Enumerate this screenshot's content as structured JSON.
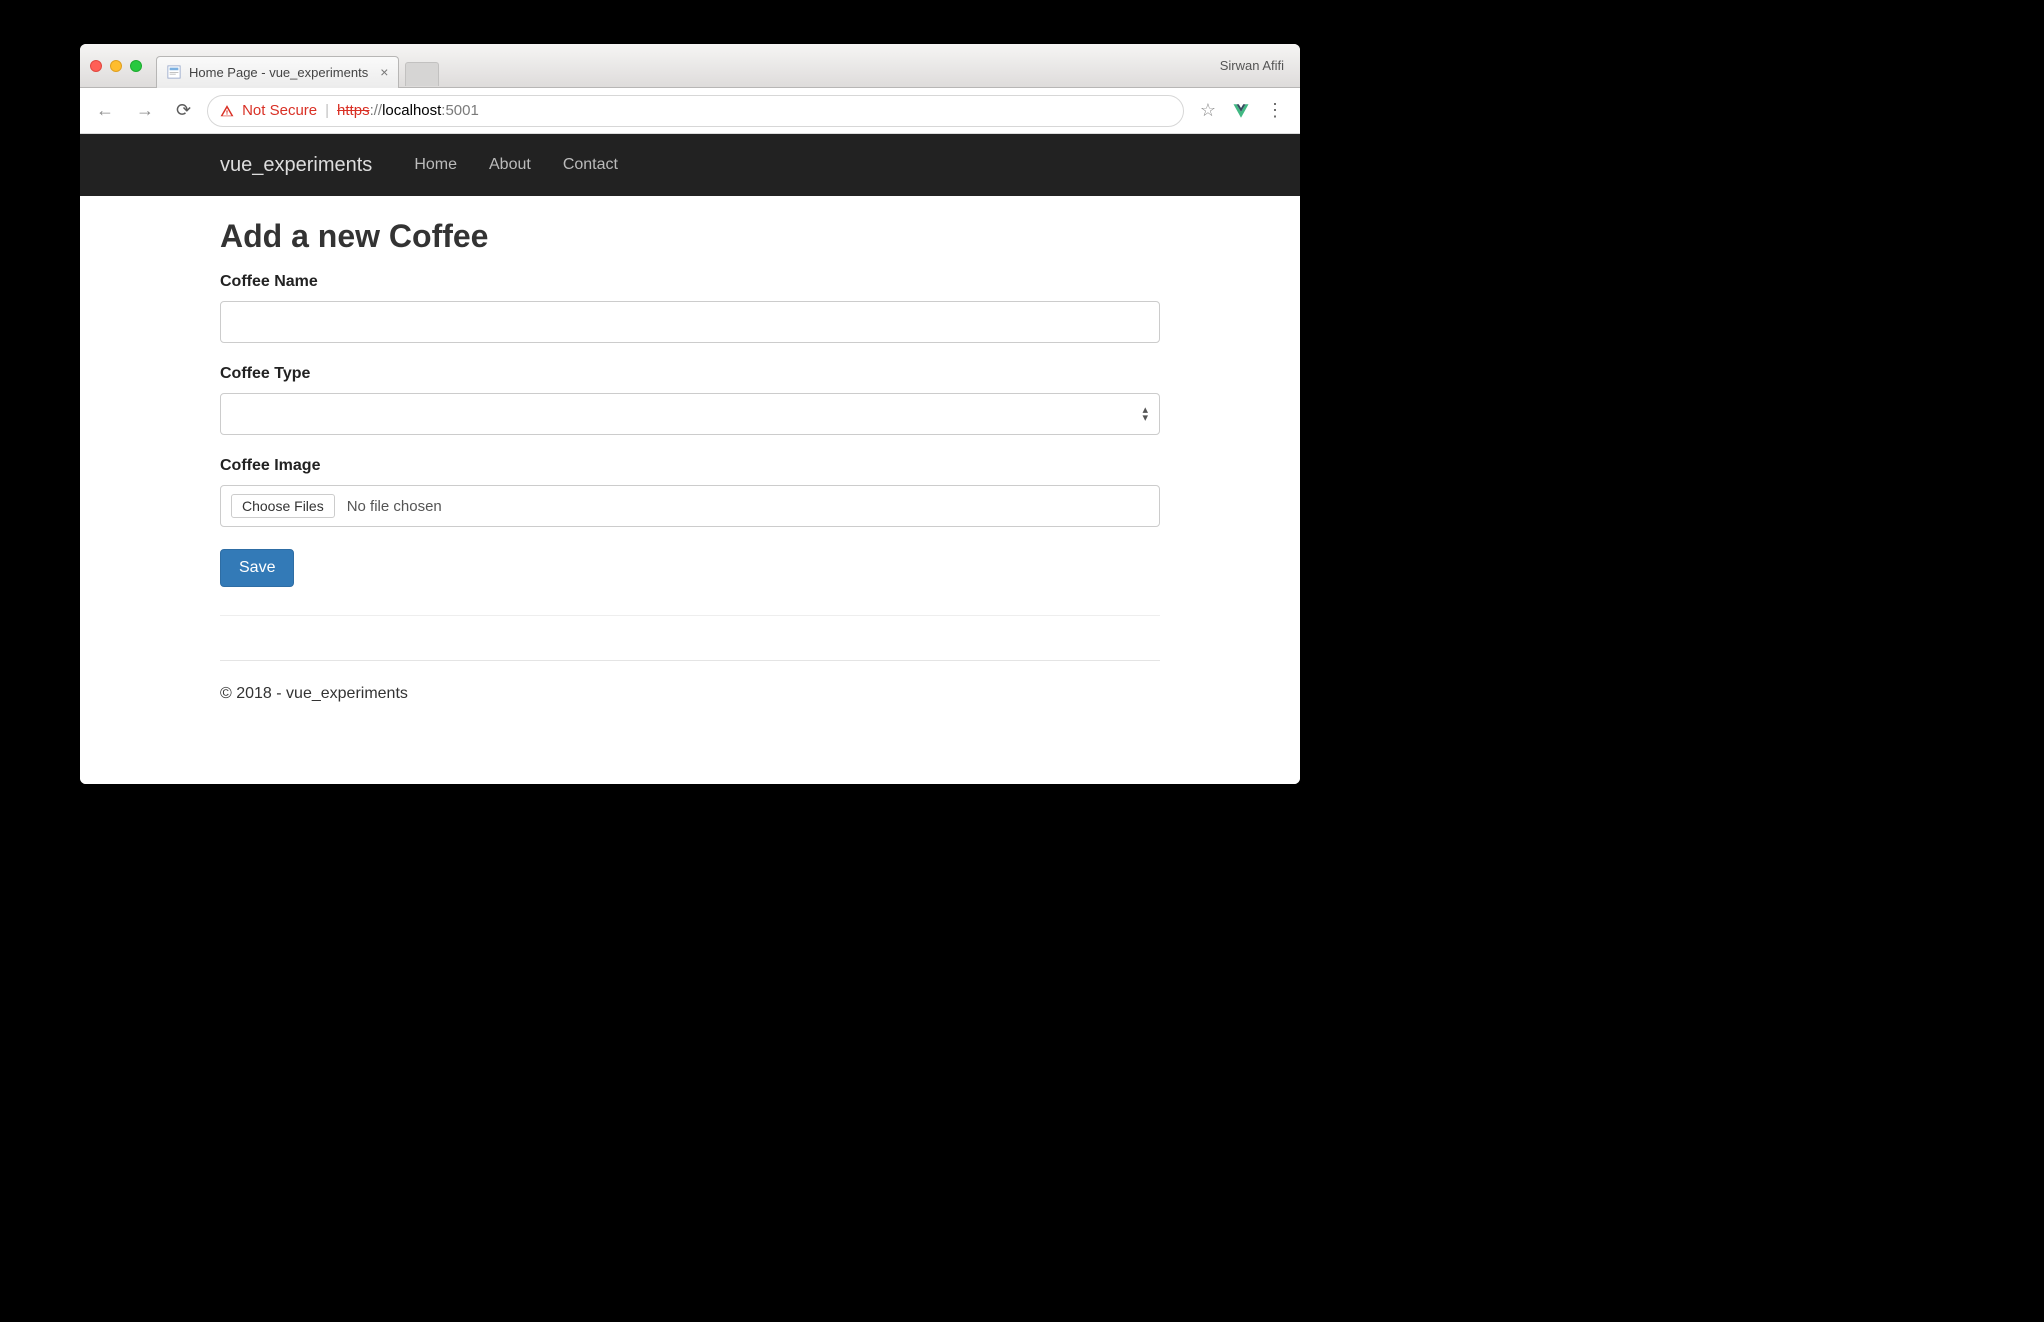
{
  "window": {
    "tab_title": "Home Page - vue_experiments",
    "profile_name": "Sirwan Afifi"
  },
  "addressbar": {
    "not_secure_label": "Not Secure",
    "url_scheme": "https",
    "url_sep": "://",
    "url_host": "localhost",
    "url_port": ":5001"
  },
  "navbar": {
    "brand": "vue_experiments",
    "links": [
      "Home",
      "About",
      "Contact"
    ]
  },
  "page": {
    "title": "Add a new Coffee",
    "fields": {
      "name_label": "Coffee Name",
      "name_value": "",
      "type_label": "Coffee Type",
      "type_value": "",
      "image_label": "Coffee Image",
      "choose_button": "Choose Files",
      "file_status": "No file chosen"
    },
    "save_button": "Save"
  },
  "footer": {
    "text": "© 2018 - vue_experiments"
  }
}
